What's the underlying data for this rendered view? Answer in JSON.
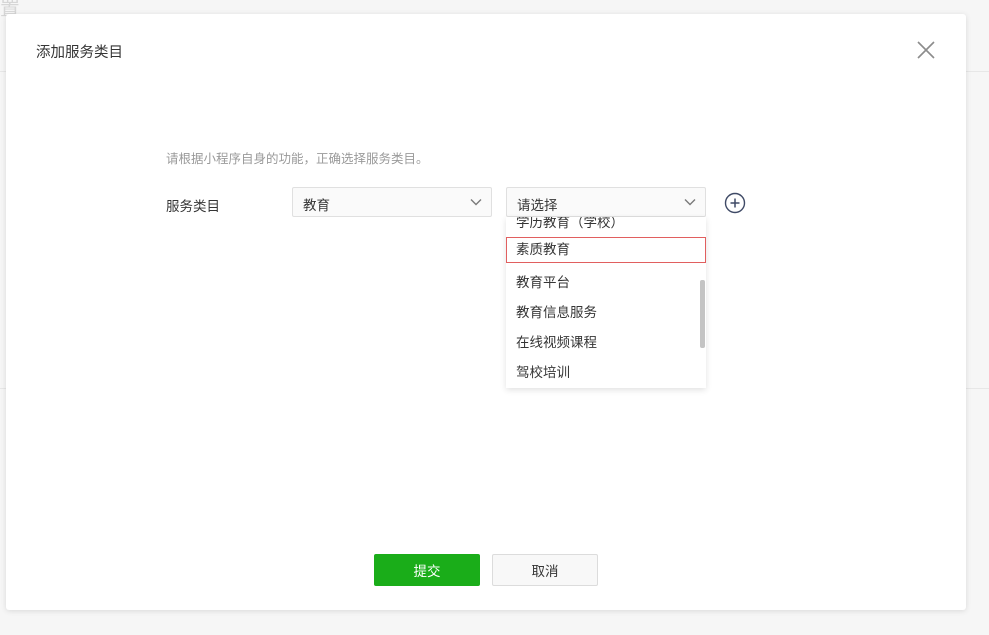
{
  "background": {
    "glyph": "置"
  },
  "modal": {
    "title": "添加服务类目",
    "hint": "请根据小程序自身的功能，正确选择服务类目。",
    "field_label": "服务类目",
    "primary_select": {
      "value": "教育"
    },
    "secondary_select": {
      "value": "请选择"
    },
    "dropdown": {
      "items": [
        "学历教育（学校）",
        "素质教育",
        "教育平台",
        "教育信息服务",
        "在线视频课程",
        "驾校培训"
      ],
      "highlighted_item": "素质教育"
    },
    "buttons": {
      "submit": "提交",
      "cancel": "取消"
    }
  },
  "colors": {
    "primary_green": "#1aad19",
    "highlight_border": "#e15f5f",
    "hint_text": "#9a9a9a"
  },
  "icons": {
    "close": "close-icon",
    "chevron": "chevron-down-icon",
    "add": "plus-circle-icon"
  }
}
